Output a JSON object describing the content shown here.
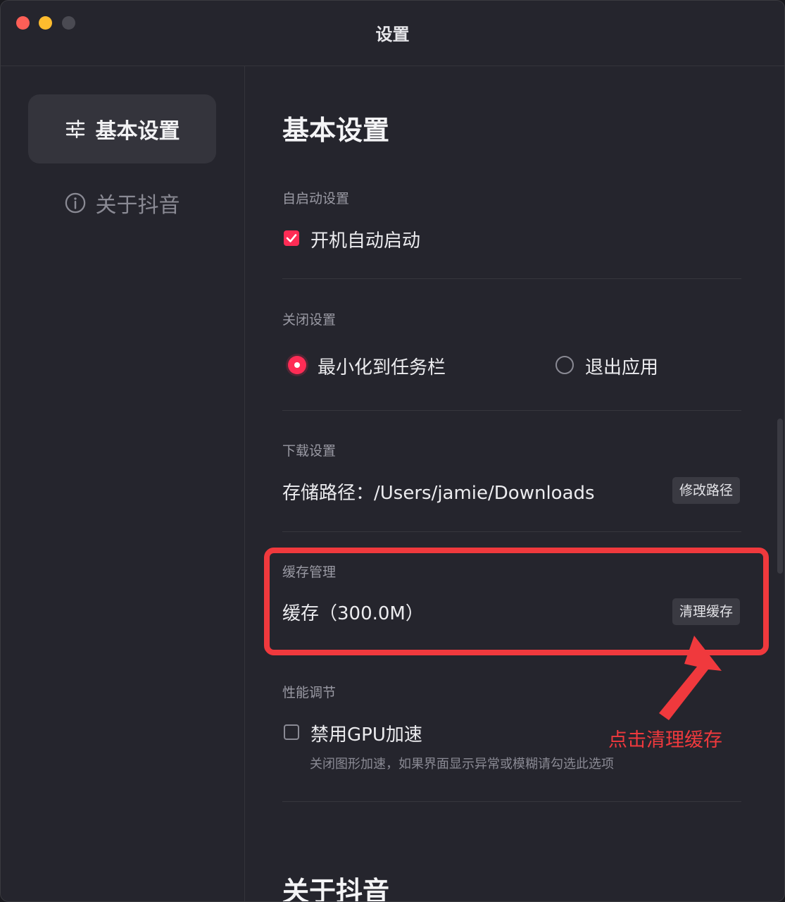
{
  "window": {
    "title": "设置"
  },
  "sidebar": {
    "items": [
      {
        "label": "基本设置",
        "icon": "sliders-icon",
        "active": true
      },
      {
        "label": "关于抖音",
        "icon": "info-circle-icon",
        "active": false
      }
    ]
  },
  "main": {
    "title": "基本设置",
    "autostart": {
      "label": "自启动设置",
      "option_label": "开机自动启动",
      "checked": true
    },
    "close": {
      "label": "关闭设置",
      "options": [
        {
          "label": "最小化到任务栏",
          "selected": true
        },
        {
          "label": "退出应用",
          "selected": false
        }
      ]
    },
    "download": {
      "label": "下载设置",
      "path_text": "存储路径：/Users/jamie/Downloads",
      "button_label": "修改路径"
    },
    "cache": {
      "label": "缓存管理",
      "value_text": "缓存（300.0M）",
      "button_label": "清理缓存"
    },
    "performance": {
      "label": "性能调节",
      "option_label": "禁用GPU加速",
      "checked": false,
      "hint": "关闭图形加速，如果界面显示异常或模糊请勾选此选项"
    },
    "about_title": "关于抖音"
  },
  "annotation": {
    "text": "点击清理缓存",
    "color": "#f0393d"
  },
  "colors": {
    "accent": "#fe2c55",
    "background": "#25252d",
    "annotation": "#f0393d"
  }
}
